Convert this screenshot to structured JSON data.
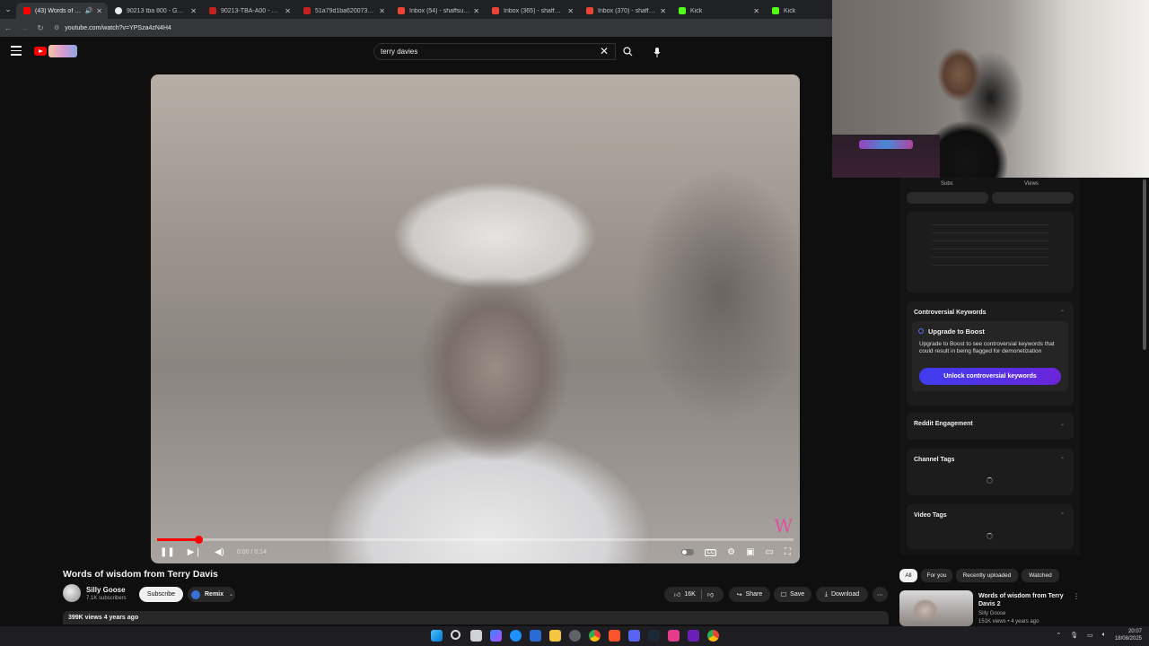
{
  "browser": {
    "tabs": [
      {
        "title": "(43) Words of wisdom",
        "favicon_color": "#ff0000",
        "active": true
      },
      {
        "title": "90213 tba 800 - Google S",
        "favicon_color": "#e8eaed",
        "active": false
      },
      {
        "title": "90213-TBA-A00 - Genuin",
        "favicon_color": "#c5221f",
        "active": false
      },
      {
        "title": "51a79d1ba620073c01e0",
        "favicon_color": "#c5221f",
        "active": false
      },
      {
        "title": "Inbox (54) - shaffsubs@g",
        "favicon_color": "#ea4335",
        "active": false
      },
      {
        "title": "Inbox (365) - shaffedclip",
        "favicon_color": "#ea4335",
        "active": false
      },
      {
        "title": "Inbox (370) - shaffedlive",
        "favicon_color": "#ea4335",
        "active": false
      },
      {
        "title": "Kick",
        "favicon_color": "#53fc18",
        "active": false
      },
      {
        "title": "Kick",
        "favicon_color": "#53fc18",
        "active": false
      }
    ],
    "url": "youtube.com/watch?v=YPSza4zN4H4"
  },
  "youtube": {
    "search_query": "terry davies",
    "video": {
      "time": "0:00 / 0:14",
      "progress_fraction": 0.065,
      "watermark": "W",
      "title": "Words of wisdom from Terry Davis",
      "channel": "Silly Goose",
      "subscribers": "7.1K subscribers",
      "subscribe_label": "Subscribe",
      "remix_label": "Remix",
      "likes": "16K",
      "share_label": "Share",
      "save_label": "Save",
      "download_label": "Download",
      "views_date": "399K views  4 years ago"
    },
    "chips": [
      "All",
      "For you",
      "Recently uploaded",
      "Watched"
    ],
    "related": {
      "title": "Words of wisdom from Terry Davis 2",
      "channel": "Silly Goose",
      "meta": "151K views • 4 years ago"
    }
  },
  "side_panel": {
    "head_labels": [
      "Subs",
      "Views"
    ],
    "controversial": {
      "title": "Controversial Keywords",
      "upgrade_title": "Upgrade to Boost",
      "upgrade_text": "Upgrade to Boost to see controversial keywords that could result in being flagged for demonetization",
      "button": "Unlock controversial keywords"
    },
    "reddit_title": "Reddit Engagement",
    "channel_tags_title": "Channel Tags",
    "video_tags_title": "Video Tags"
  },
  "taskbar": {
    "time": "20:07",
    "date": "18/08/2025"
  }
}
